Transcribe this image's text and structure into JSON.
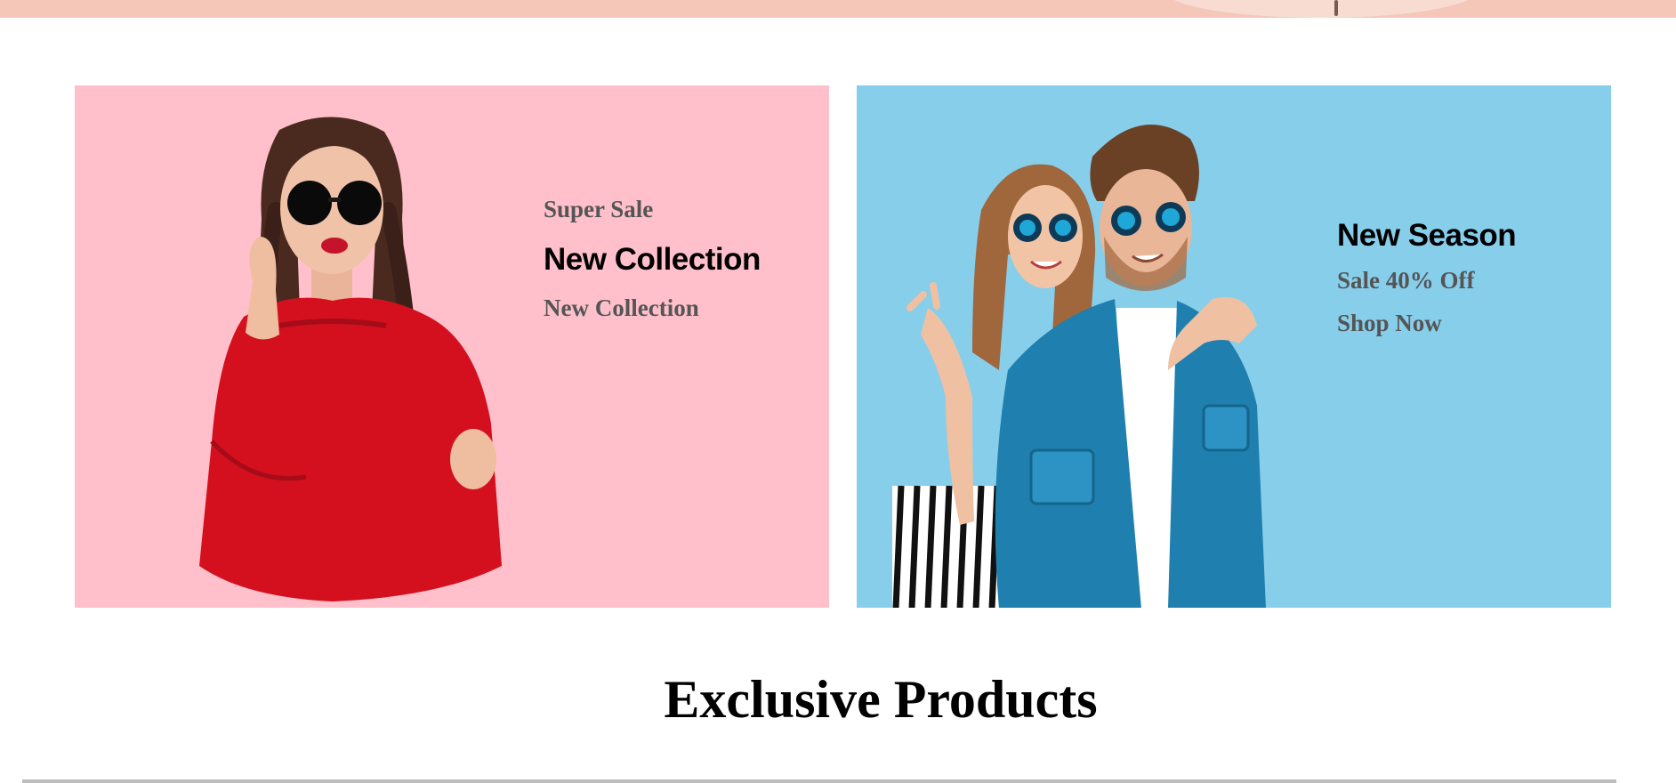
{
  "colors": {
    "top_banner": "#f4c7b8",
    "promo_left_bg": "#ffc0cb",
    "promo_right_bg": "#87ceeb",
    "muted_text": "#555555",
    "heading_text": "#000000"
  },
  "promos": [
    {
      "eyebrow": "Super Sale",
      "title": "New Collection",
      "subtitle": "New Collection",
      "image": "woman-red-sweater-sunglasses"
    },
    {
      "title": "New Season",
      "subtitle": "Sale 40% Off",
      "cta": "Shop Now",
      "image": "couple-denim-sunglasses"
    }
  ],
  "section": {
    "title": "Exclusive Products"
  }
}
